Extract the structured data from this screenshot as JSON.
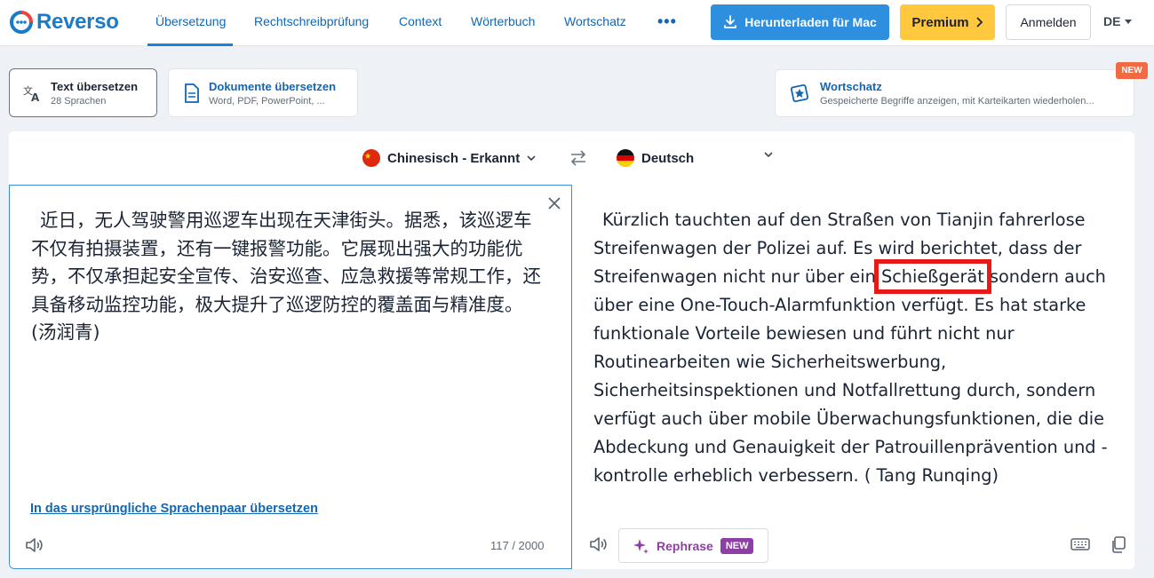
{
  "header": {
    "logo": "Reverso",
    "nav": [
      "Übersetzung",
      "Rechtschreibprüfung",
      "Context",
      "Wörterbuch",
      "Wortschatz"
    ],
    "more": "•••",
    "download_label": "Herunterladen für Mac",
    "premium_label": "Premium",
    "login_label": "Anmelden",
    "ui_lang": "DE"
  },
  "modes": {
    "text": {
      "title": "Text übersetzen",
      "sub": "28 Sprachen"
    },
    "docs": {
      "title": "Dokumente übersetzen",
      "sub": "Word, PDF, PowerPoint, ..."
    },
    "vocab": {
      "title": "Wortschatz",
      "sub": "Gespeicherte Begriffe anzeigen, mit Karteikarten wiederholen...",
      "badge": "NEW"
    }
  },
  "translator": {
    "source_lang": "Chinesisch - Erkannt",
    "target_lang": "Deutsch",
    "source_text": "近日，无人驾驶警用巡逻车出现在天津街头。据悉，该巡逻车不仅有拍摄装置，还有一键报警功能。它展现出强大的功能优势，不仅承担起安全宣传、治安巡查、应急救援等常规工作，还具备移动监控功能，极大提升了巡逻防控的覆盖面与精准度。(汤润青)",
    "target_pre": "Kürzlich tauchten auf den Straßen von Tianjin fahrerlose Streifenwagen der Polizei auf. Es wird berichtet, dass der Streifenwagen nicht nur über ein ",
    "target_highlight": "Schießgerät",
    "target_post": " sondern auch über eine One-Touch-Alarmfunktion verfügt. Es hat starke funktionale Vorteile bewiesen und führt nicht nur Routinearbeiten wie Sicherheitswerbung, Sicherheitsinspektionen und Notfallrettung durch, sondern verfügt auch über mobile Überwachungsfunktionen, die die Abdeckung und Genauigkeit der Patrouillenprävention und -kontrolle erheblich verbessern. ( Tang Runqing)",
    "source_link": "In das ursprüngliche Sprachenpaar übersetzen",
    "char_count": "117 / 2000",
    "rephrase_label": "Rephrase",
    "rephrase_badge": "NEW"
  },
  "colors": {
    "brand": "#1a7cc8",
    "premium": "#ffc83d",
    "download": "#2f8fdf",
    "highlight": "#e41b17",
    "rephrase": "#8e3fa4"
  }
}
